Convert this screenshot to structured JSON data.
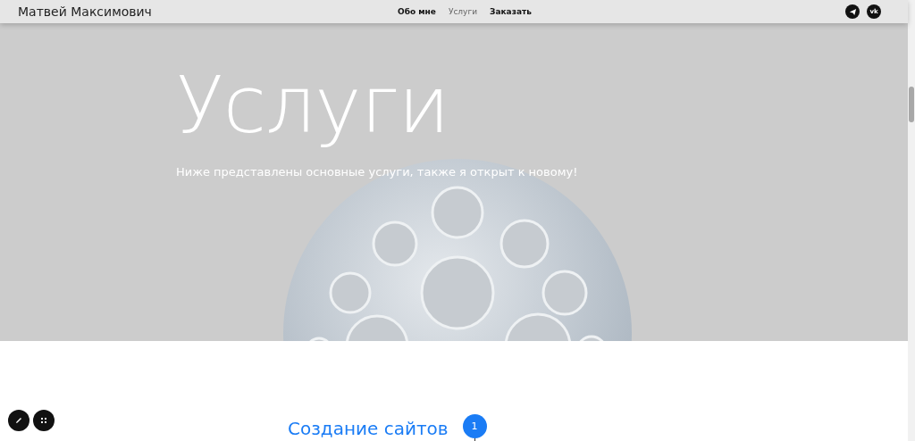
{
  "header": {
    "site_name": "Матвей Максимович",
    "nav": [
      {
        "label": "Обо мне",
        "selected": false
      },
      {
        "label": "Услуги",
        "selected": true
      },
      {
        "label": "Заказать",
        "selected": false
      }
    ],
    "social": [
      {
        "kind": "telegram"
      },
      {
        "kind": "vk",
        "text": "vk"
      }
    ]
  },
  "hero": {
    "title": "Услуги",
    "subtitle": "Ниже представлены основные услуги, также я открыт к новому!"
  },
  "services": [
    {
      "title": "Создание сайтов",
      "number": "1"
    }
  ],
  "floating_buttons": [
    {
      "kind": "edit"
    },
    {
      "kind": "expand"
    }
  ]
}
